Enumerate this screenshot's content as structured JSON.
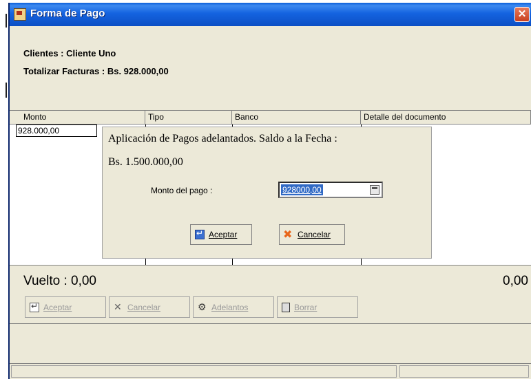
{
  "window": {
    "title": "Forma de Pago",
    "close_symbol": "✕"
  },
  "info": {
    "clientes": "Clientes  : Cliente Uno",
    "totalizar": "Totalizar Facturas  : Bs. 928.000,00"
  },
  "grid": {
    "columns": [
      "Monto",
      "Tipo",
      "Banco",
      "Detalle del documento"
    ],
    "rows": [
      {
        "monto": "928.000,00"
      }
    ]
  },
  "vuelto": {
    "label": "Vuelto : 0,00",
    "right_value": "0,00"
  },
  "buttons": {
    "aceptar": "Aceptar",
    "cancelar": "Cancelar",
    "adelantos": "Adelantos",
    "borrar": "Borrar"
  },
  "dialog": {
    "title": "Aplicación de Pagos adelantados. Saldo a la Fecha :",
    "saldo": "Bs. 1.500.000,00",
    "monto_label": "Monto del pago :",
    "monto_value": "928000,00",
    "aceptar": "Aceptar",
    "cancelar": "Cancelar"
  },
  "icons": {
    "app": "app-icon",
    "enter": "enter-icon",
    "cancel": "cancel-x-icon",
    "adelantos": "adelantos-icon",
    "trash": "trash-icon",
    "calculator": "calculator-icon"
  },
  "colors": {
    "titlebar": "#0c4fc4",
    "selection": "#316ac5",
    "cancel_icon": "#e8661a",
    "window_bg": "#ece9d8"
  }
}
